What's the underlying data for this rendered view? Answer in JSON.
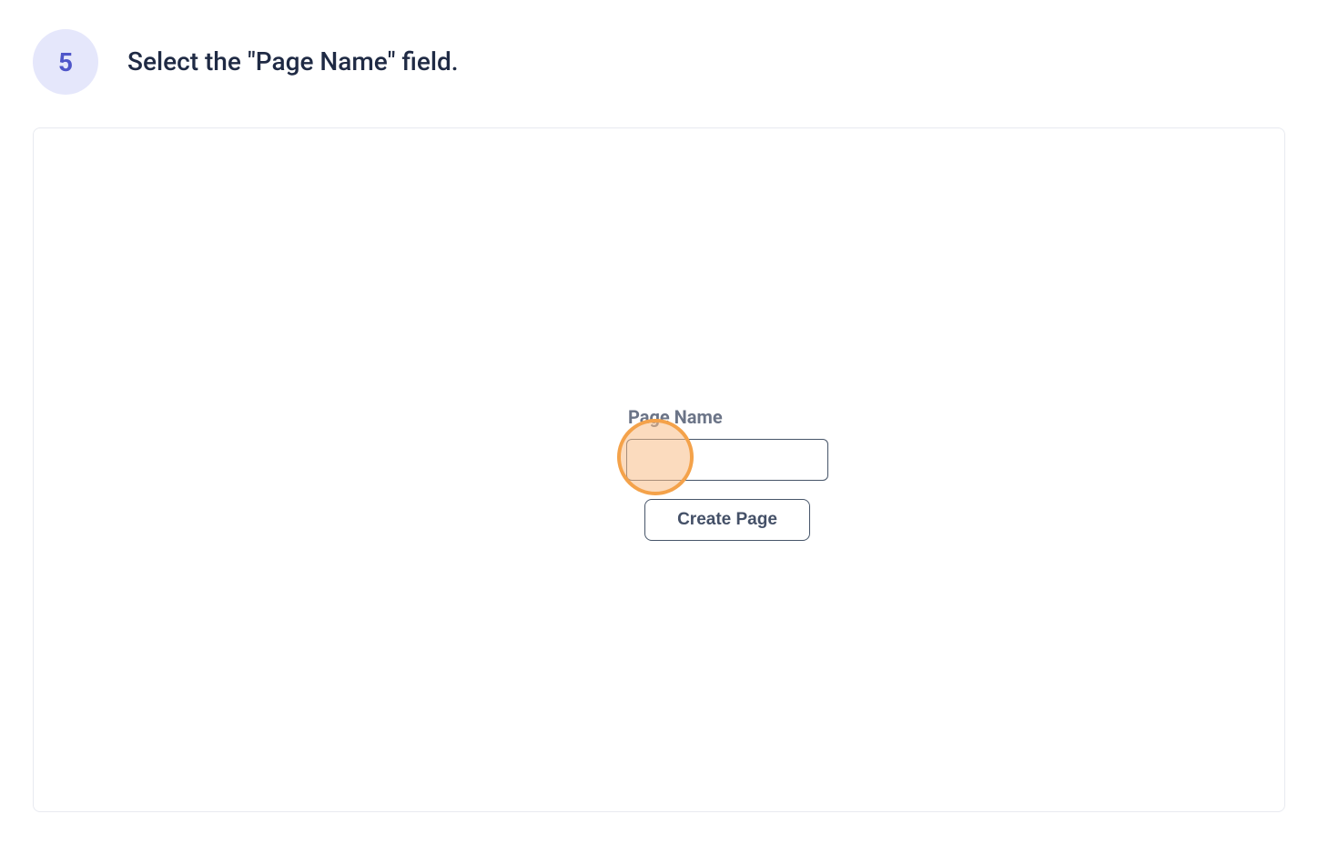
{
  "step": {
    "number": "5",
    "title": "Select the \"Page Name\" field."
  },
  "form": {
    "label": "Page Name",
    "input_value": "",
    "button_label": "Create Page"
  }
}
